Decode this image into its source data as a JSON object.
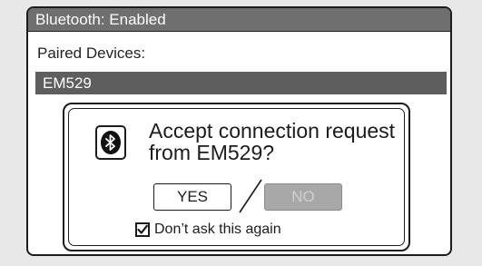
{
  "titlebar": {
    "title": "Bluetooth: Enabled"
  },
  "paired": {
    "label": "Paired Devices:",
    "devices": [
      {
        "name": "EM529",
        "selected": true
      }
    ]
  },
  "dialog": {
    "icon": "bluetooth-icon",
    "message_line1": "Accept connection request",
    "message_line2": "from EM529?",
    "yes_label": "YES",
    "no_label": "NO",
    "checkbox_label": "Don’t ask this again",
    "checkbox_checked": true
  },
  "colors": {
    "titlebar_bg": "#6f6f6f",
    "selected_row_bg": "#5e5e5e",
    "disabled_button_bg": "#a8a8a8",
    "outline": "#1c1c1c"
  }
}
